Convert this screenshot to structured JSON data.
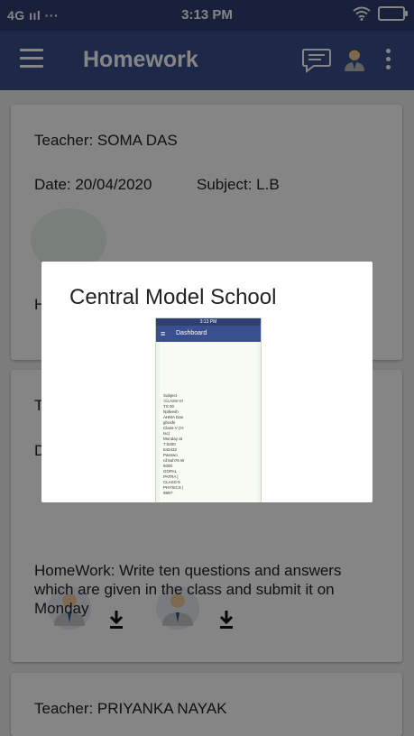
{
  "status_bar": {
    "network": "4G ııl ···",
    "time": "3:13 PM"
  },
  "app_bar": {
    "title": "Homework"
  },
  "cards": [
    {
      "teacher": "Teacher:  SOMA  DAS",
      "date": "Date: 20/04/2020",
      "subject": "Subject: L.B",
      "hw_partial": "H"
    },
    {
      "teacher_partial": "T",
      "date_partial": "D",
      "homework": "HomeWork: Write ten questions and answers which  are given in the class and submit it on Monday"
    },
    {
      "teacher": "Teacher: PRIYANKA NAYAK"
    }
  ],
  "dialog": {
    "title": "Central Model School",
    "preview": {
      "time": "3:13 PM",
      "app_title": "Dashboard",
      "lines": "Subject :CLASS-VI TS 00 Nafeesh AHMA Das ghoshi Class-V (H-Isc) Monday at 7:0400 542432 Passwo rd:5uh76 W 5000 GOPAL PATRA | CLASS-5 PHYSICS | 9897-"
    }
  }
}
